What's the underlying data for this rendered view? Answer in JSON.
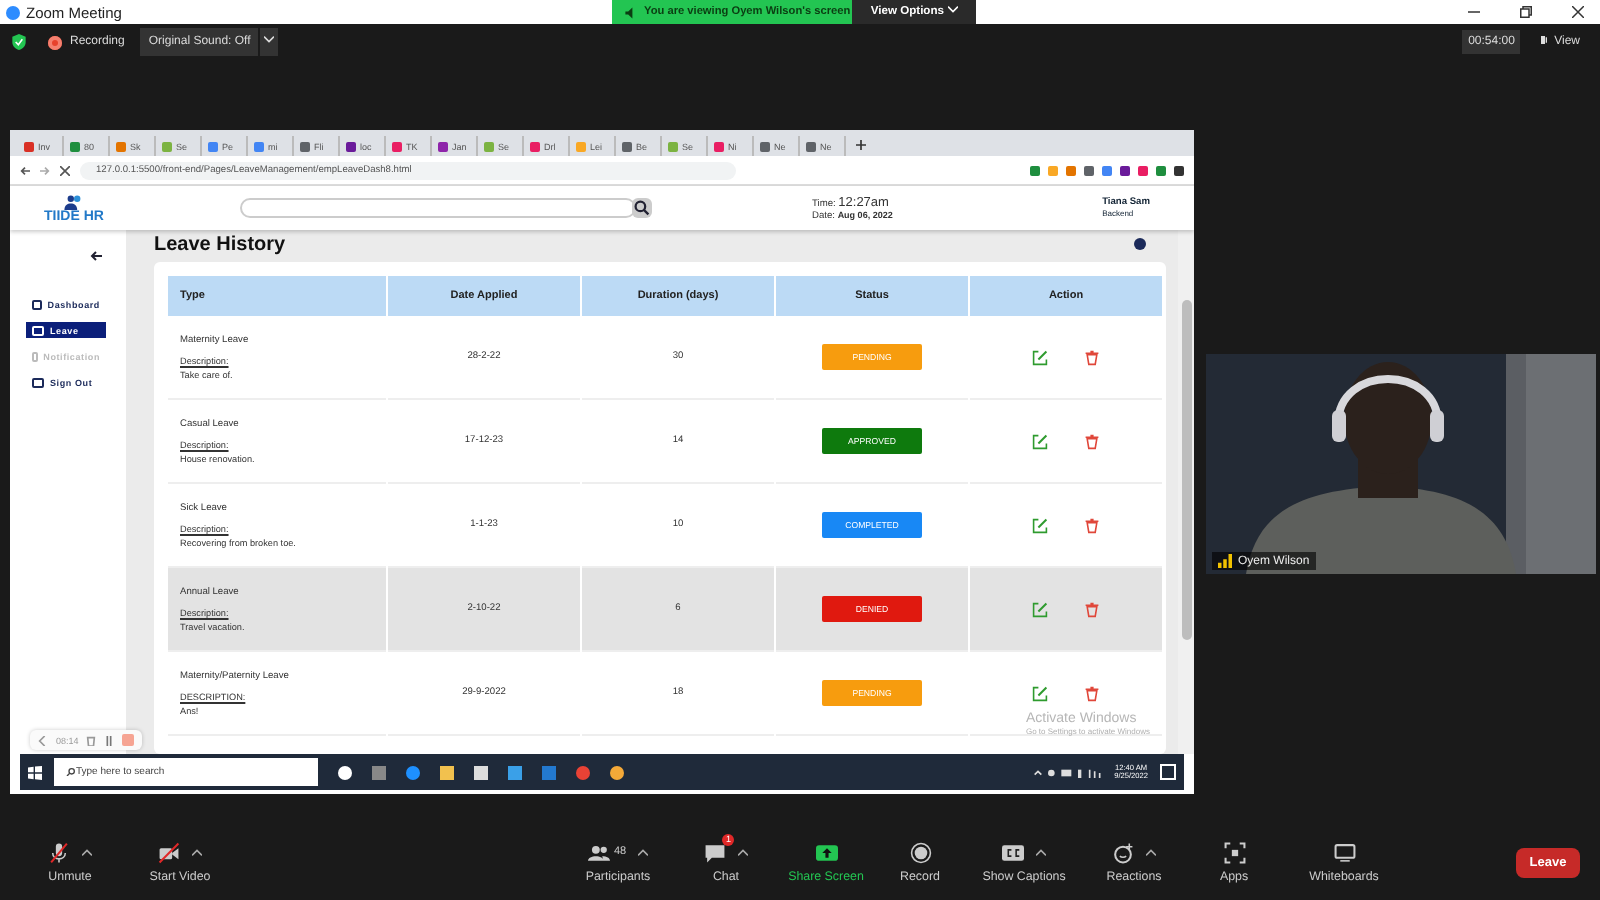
{
  "zoom_window": {
    "title": "Zoom Meeting",
    "banner": "You are viewing Oyem Wilson's screen",
    "view_options": "View Options"
  },
  "meeting_bar": {
    "recording": "Recording",
    "sound": "Original Sound: Off",
    "timer": "00:54:00",
    "view": "View"
  },
  "browser": {
    "tabs": [
      {
        "label": "Inv",
        "color": "#d93025"
      },
      {
        "label": "80",
        "color": "#1e8e3e"
      },
      {
        "label": "Sk",
        "color": "#e37400"
      },
      {
        "label": "Se",
        "color": "#7cb342"
      },
      {
        "label": "Pe",
        "color": "#4285f4"
      },
      {
        "label": "mi",
        "color": "#4285f4"
      },
      {
        "label": "Fli",
        "color": "#5f6368"
      },
      {
        "label": "loc",
        "color": "#6a1b9a"
      },
      {
        "label": "TK",
        "color": "#e91e63"
      },
      {
        "label": "Jan",
        "color": "#8e24aa"
      },
      {
        "label": "Se",
        "color": "#7cb342"
      },
      {
        "label": "Drl",
        "color": "#e91e63"
      },
      {
        "label": "Lei",
        "color": "#f9a825"
      },
      {
        "label": "Be",
        "color": "#5f6368"
      },
      {
        "label": "Se",
        "color": "#7cb342"
      },
      {
        "label": "Ni",
        "color": "#e91e63"
      },
      {
        "label": "Ne",
        "color": "#5f6368"
      },
      {
        "label": "Ne",
        "color": "#5f6368"
      }
    ],
    "url": "127.0.0.1:5500/front-end/Pages/LeaveManagement/empLeaveDash8.html"
  },
  "app": {
    "logo": "TIIDE HR",
    "time_label": "Time:",
    "time": "12:27am",
    "date_label": "Date:",
    "date": "Aug 06, 2022",
    "user": "Tiana Sam",
    "role": "Backend",
    "nav": [
      {
        "label": "Dashboard",
        "selected": false,
        "disabled": false
      },
      {
        "label": "Leave",
        "selected": true,
        "disabled": false
      },
      {
        "label": "Notification",
        "selected": false,
        "disabled": true
      },
      {
        "label": "Sign Out",
        "selected": false,
        "disabled": false
      }
    ],
    "heading": "Leave History",
    "columns": [
      "Type",
      "Date Applied",
      "Duration (days)",
      "Status",
      "Action"
    ],
    "rows": [
      {
        "type": "Maternity Leave",
        "desc_label": "Description:",
        "description": "Take care of.",
        "date": "28-2-22",
        "duration": "30",
        "status": "PENDING",
        "color": "#f79c0e",
        "selected": false
      },
      {
        "type": "Casual Leave",
        "desc_label": "Description:",
        "description": "House renovation.",
        "date": "17-12-23",
        "duration": "14",
        "status": "APPROVED",
        "color": "#0e7a0d",
        "selected": false
      },
      {
        "type": "Sick Leave",
        "desc_label": "Description:",
        "description": "Recovering from broken toe.",
        "date": "1-1-23",
        "duration": "10",
        "status": "COMPLETED",
        "color": "#1888f5",
        "selected": false
      },
      {
        "type": "Annual Leave",
        "desc_label": "Description:",
        "description": "Travel vacation.",
        "date": "2-10-22",
        "duration": "6",
        "status": "DENIED",
        "color": "#e0190f",
        "selected": true
      },
      {
        "type": "Maternity/Paternity Leave",
        "desc_label": "DESCRIPTION:",
        "description": "Ans!",
        "date": "29-9-2022",
        "duration": "18",
        "status": "PENDING",
        "color": "#f79c0e",
        "selected": false
      }
    ]
  },
  "recorder": {
    "time": "08:14"
  },
  "os_notice": {
    "title": "Activate Windows",
    "hint": "Go to Settings to activate Windows"
  },
  "taskbar": {
    "search": "Type here to search",
    "time": "12:40 AM",
    "date": "9/25/2022"
  },
  "video": {
    "name": "Oyem Wilson"
  },
  "toolbar": [
    {
      "label": "Unmute",
      "kind": "mic"
    },
    {
      "label": "Start Video",
      "kind": "camera"
    },
    {
      "label": "Participants",
      "kind": "people",
      "count": "48"
    },
    {
      "label": "Chat",
      "kind": "chat",
      "badge": "1"
    },
    {
      "label": "Share Screen",
      "kind": "share"
    },
    {
      "label": "Record",
      "kind": "record"
    },
    {
      "label": "Show Captions",
      "kind": "captions"
    },
    {
      "label": "Reactions",
      "kind": "reactions"
    },
    {
      "label": "Apps",
      "kind": "apps"
    },
    {
      "label": "Whiteboards",
      "kind": "whiteboard"
    }
  ],
  "leave": "Leave"
}
